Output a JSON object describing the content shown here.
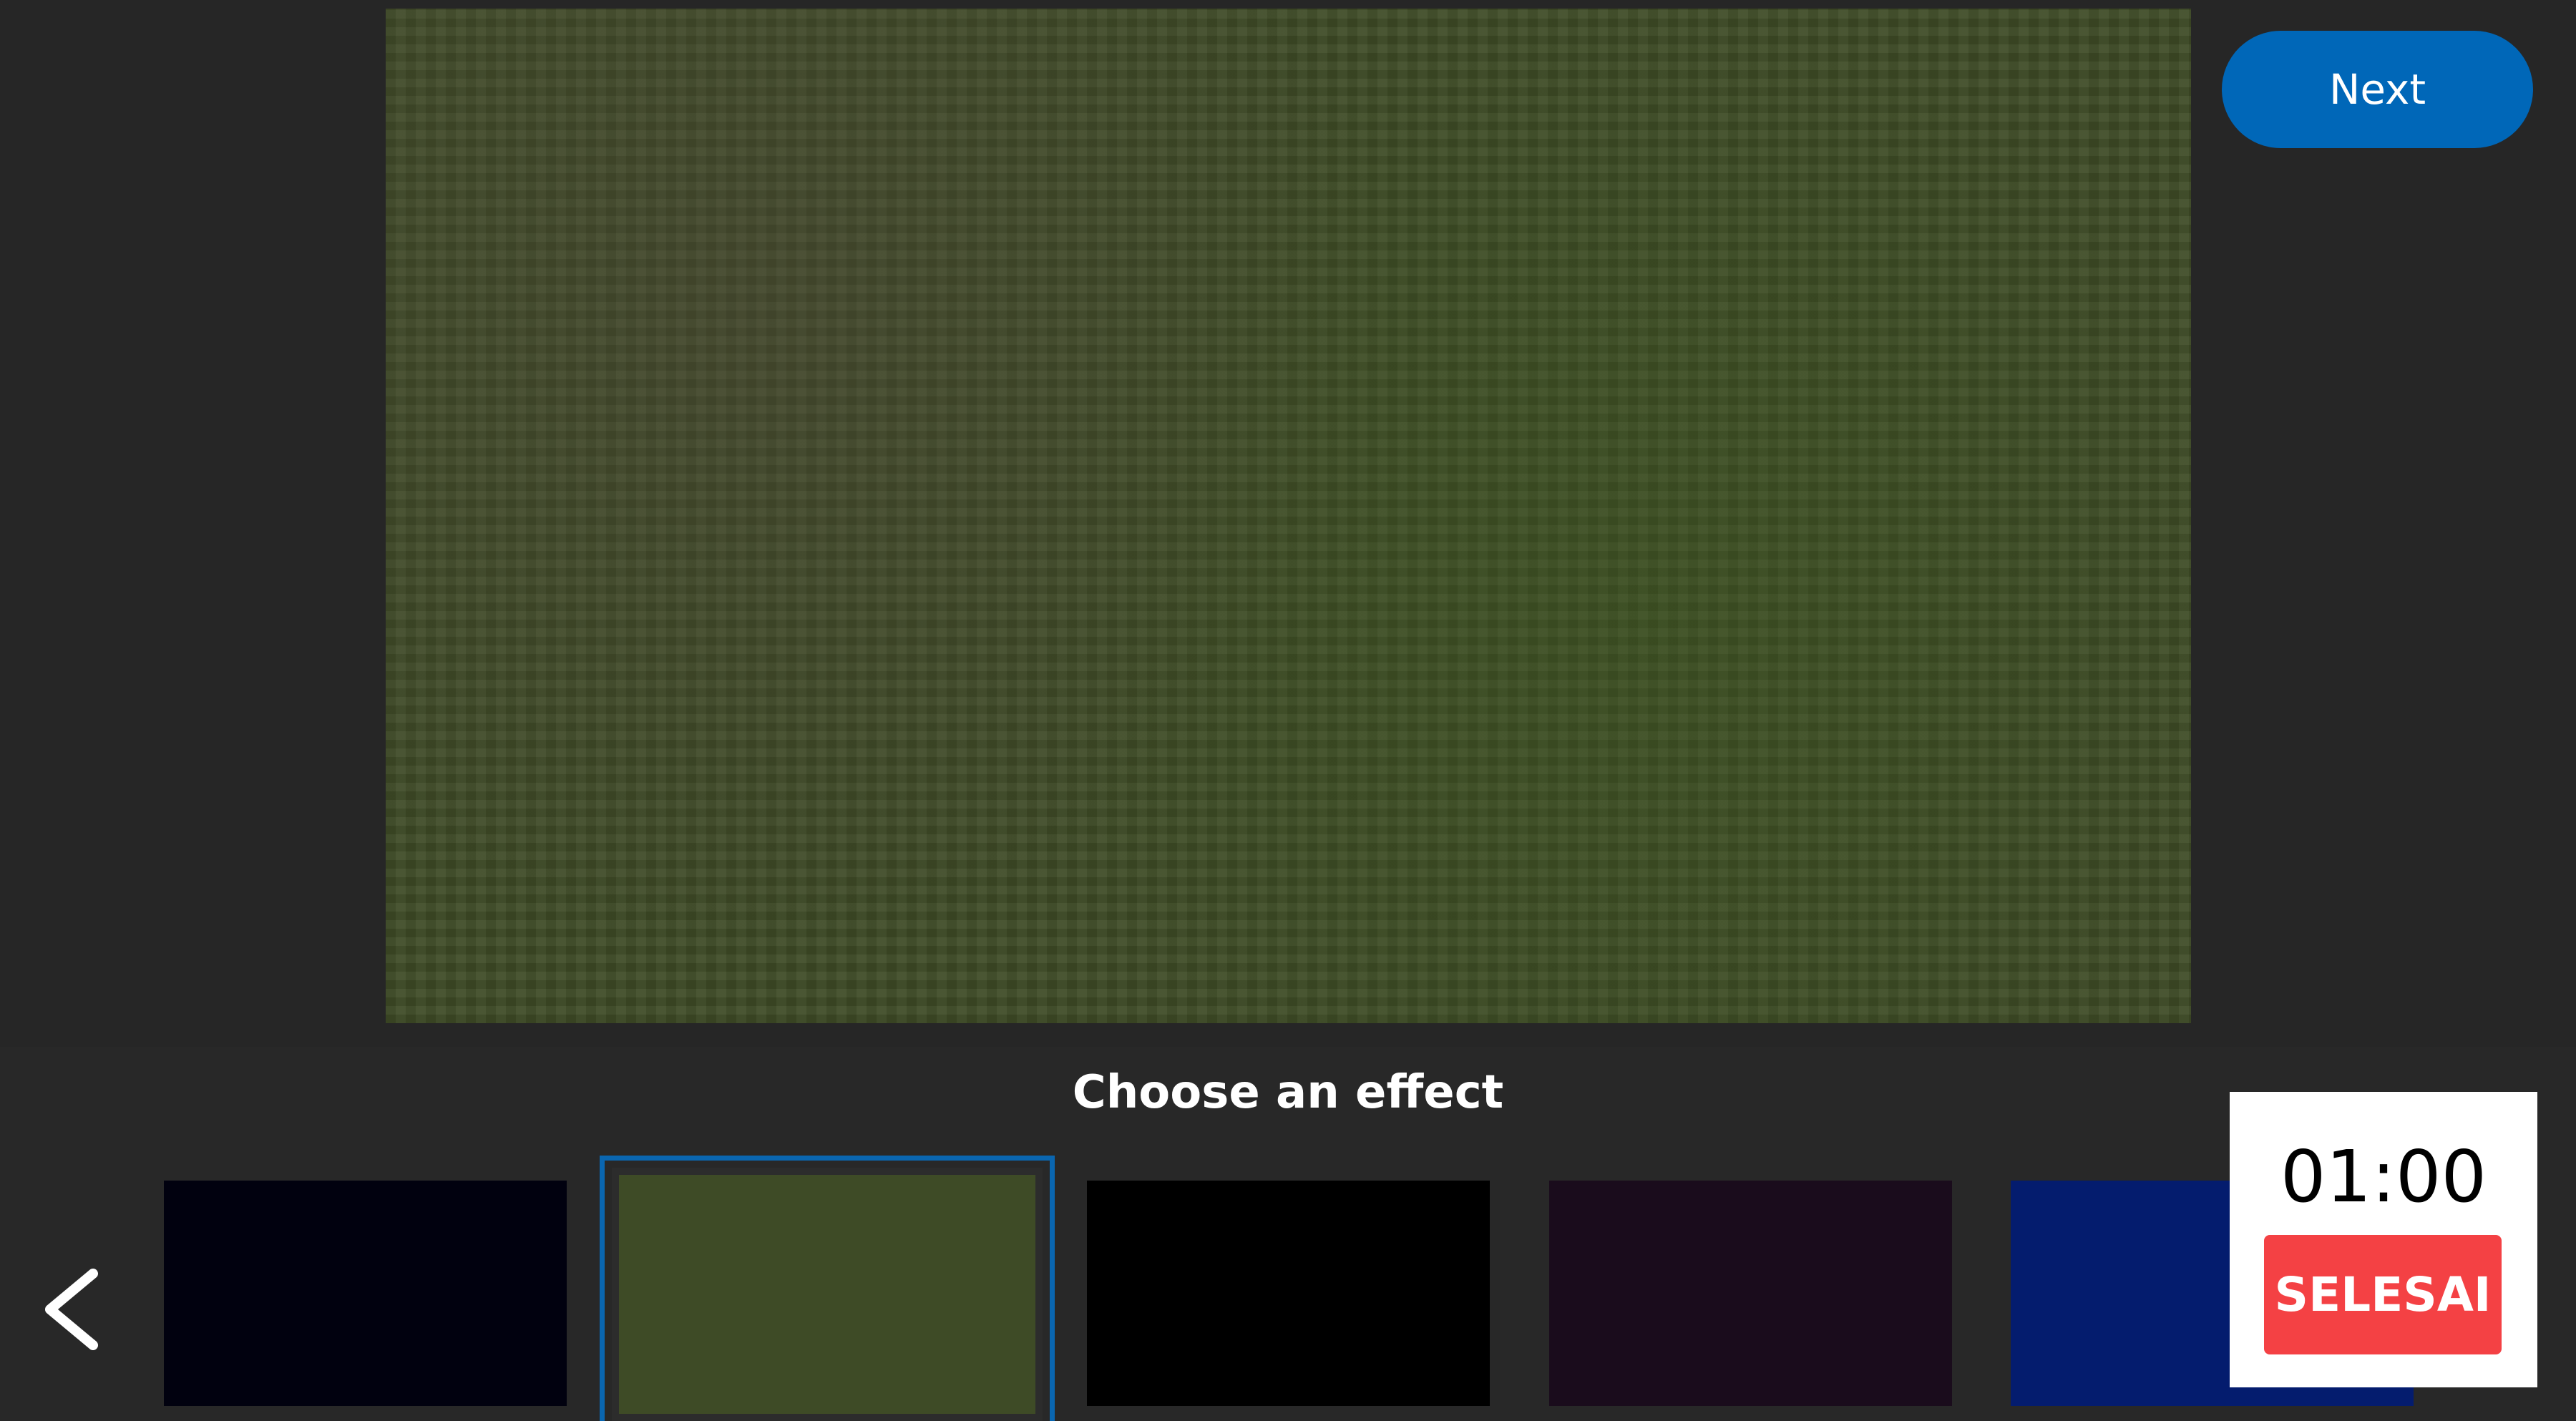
{
  "toolbar": {
    "next_label": "Next"
  },
  "effects_panel": {
    "title": "Choose an effect",
    "thumbnails": [
      {
        "name": "effect-1",
        "color": "#01010f",
        "selected": false
      },
      {
        "name": "effect-2",
        "color": "#3e4b26",
        "selected": true
      },
      {
        "name": "effect-3",
        "color": "#000000",
        "selected": false
      },
      {
        "name": "effect-4",
        "color": "#1a0c1c",
        "selected": false
      },
      {
        "name": "effect-5",
        "color": "#041c6e",
        "selected": false
      }
    ]
  },
  "timer": {
    "value": "01:00",
    "finish_label": "SELESAI"
  },
  "colors": {
    "accent": "#0067b8",
    "finish": "#f44144",
    "background": "#262626",
    "selected_outline": "#0a66b0"
  },
  "icons": {
    "back": "chevron-left-icon"
  }
}
